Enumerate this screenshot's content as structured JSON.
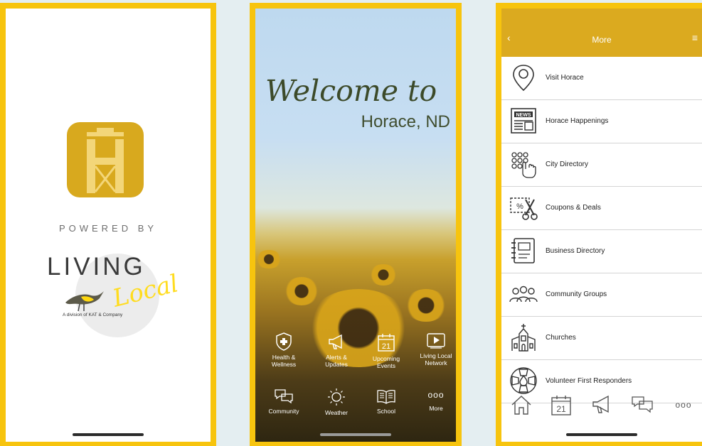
{
  "splash": {
    "powered_by": "POWERED BY",
    "logo_word_1": "LIVING",
    "logo_word_2": "Local",
    "logo_sub": "A division of KAT & Company"
  },
  "welcome": {
    "headline": "Welcome to",
    "city": "Horace, ND",
    "items": [
      {
        "label": "Health &\nWellness",
        "icon": "shield-cross-icon"
      },
      {
        "label": "Alerts &\nUpdates",
        "icon": "megaphone-icon"
      },
      {
        "label": "Upcoming\nEvents",
        "icon": "calendar-icon",
        "day": "21"
      },
      {
        "label": "Living Local\nNetwork",
        "icon": "play-icon"
      },
      {
        "label": "Community",
        "icon": "chat-bubbles-icon"
      },
      {
        "label": "Weather",
        "icon": "sun-icon"
      },
      {
        "label": "School",
        "icon": "book-icon"
      },
      {
        "label": "More",
        "icon": "more-dots-icon",
        "glyph": "ooo"
      }
    ]
  },
  "more": {
    "title": "More",
    "items": [
      {
        "label": "Visit Horace",
        "icon": "map-pin-icon"
      },
      {
        "label": "Horace Happenings",
        "icon": "newspaper-icon"
      },
      {
        "label": "City Directory",
        "icon": "keypad-hand-icon"
      },
      {
        "label": "Coupons & Deals",
        "icon": "scissors-coupon-icon"
      },
      {
        "label": "Business Directory",
        "icon": "address-book-icon"
      },
      {
        "label": "Community Groups",
        "icon": "people-icon"
      },
      {
        "label": "Churches",
        "icon": "church-icon"
      },
      {
        "label": "Volunteer First Responders",
        "icon": "fire-badge-icon"
      }
    ],
    "tabbar": [
      {
        "icon": "home-icon"
      },
      {
        "icon": "calendar-icon",
        "day": "21"
      },
      {
        "icon": "megaphone-icon"
      },
      {
        "icon": "chat-bubbles-icon"
      },
      {
        "icon": "more-dots-icon",
        "glyph": "ooo"
      }
    ]
  },
  "colors": {
    "accent": "#f7c40e",
    "header": "#dbaa1f",
    "app_icon": "#d8a91e",
    "background": "#e4eef1"
  }
}
